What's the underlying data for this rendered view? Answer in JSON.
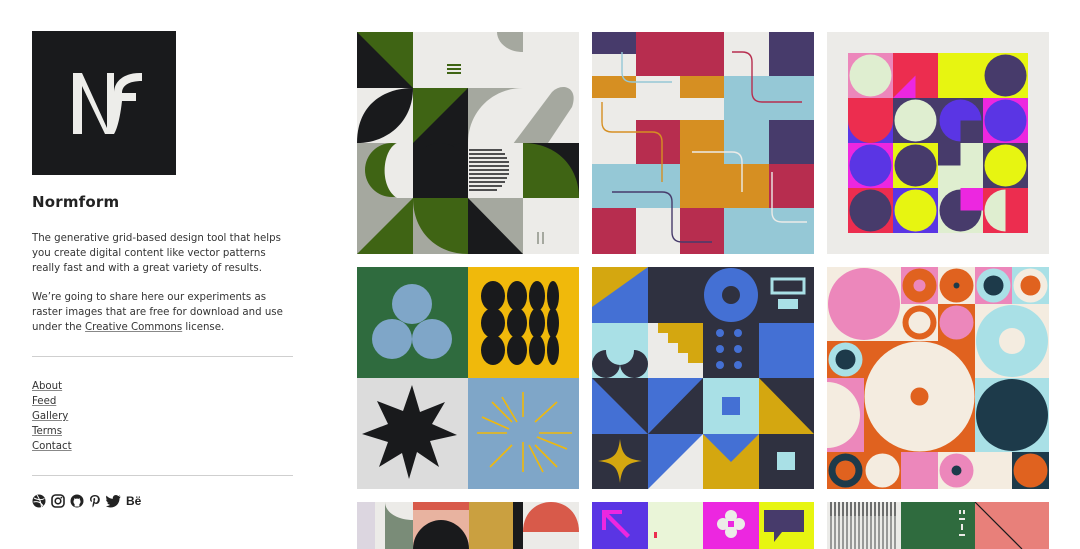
{
  "site": {
    "title": "Normform",
    "description": "The generative grid-based design tool that helps you create digital content like vector patterns really fast and with a great variety of results.",
    "share_before": "We’re going to share here our experiments as raster images that are free for download and use under the ",
    "share_link": "Creative Commons",
    "share_after": " license."
  },
  "nav": {
    "about": "About",
    "feed": "Feed",
    "gallery": "Gallery",
    "terms": "Terms",
    "contact": "Contact"
  },
  "social": [
    "dribbble-icon",
    "instagram-icon",
    "github-icon",
    "pinterest-icon",
    "twitter-icon",
    "behance-icon"
  ],
  "social_labels": {
    "behance": "Bë"
  },
  "colors": {
    "logo_bg": "#191a1c",
    "green": "#3f6414",
    "gray": "#a5a89f",
    "crimson": "#b72d4f",
    "ochre": "#d68f22",
    "light_blue": "#95c8d6",
    "purple": "#473b6b",
    "lime": "#e7f511",
    "pink": "#ec87bb",
    "orange": "#e0621f",
    "blue": "#4470d4",
    "yellow": "#f0b90b"
  }
}
